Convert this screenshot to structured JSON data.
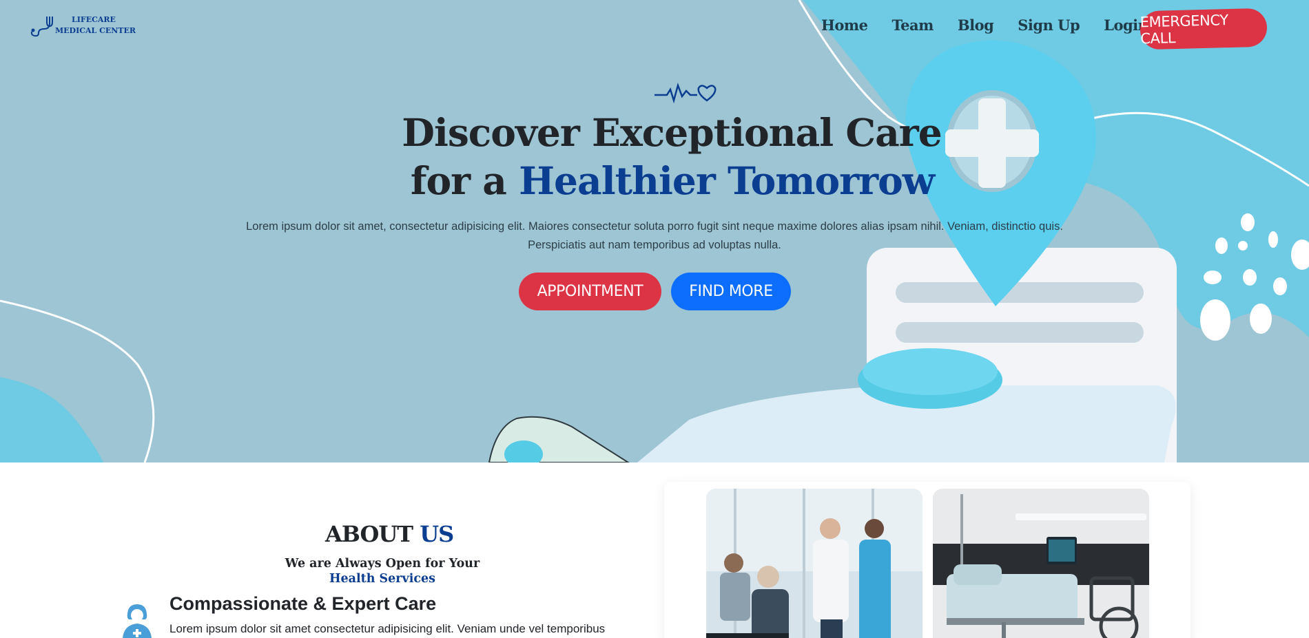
{
  "brand": {
    "line1": "LIFECARE",
    "line2": "MEDICAL CENTER"
  },
  "nav": {
    "items": [
      "Home",
      "Team",
      "Blog",
      "Sign Up",
      "Login"
    ],
    "emergency_label": "EMERGENCY CALL"
  },
  "hero": {
    "headline_line1": "Discover Exceptional Care",
    "headline_line2_prefix": "for a ",
    "headline_line2_highlight": "Healthier Tomorrow",
    "description": "Lorem ipsum dolor sit amet, consectetur adipisicing elit. Maiores consectetur soluta porro fugit sint neque maxime dolores alias ipsam nihil. Veniam, distinctio quis. Perspiciatis aut nam temporibus ad voluptas nulla.",
    "appointment_label": "APPOINTMENT",
    "find_more_label": "FIND MORE"
  },
  "about": {
    "title_main": "ABOUT",
    "title_highlight": "US",
    "subtitle_line1": "We are Always Open for Your",
    "subtitle_line2": "Health Services",
    "feature_title": "Compassionate & Expert Care",
    "feature_desc": "Lorem ipsum dolor sit amet consectetur adipisicing elit. Veniam unde vel temporibus"
  },
  "colors": {
    "hero_bg": "#9ec5d3",
    "accent_red": "#dc3445",
    "accent_blue": "#0d6efd",
    "brand_navy": "#0b3d91"
  }
}
